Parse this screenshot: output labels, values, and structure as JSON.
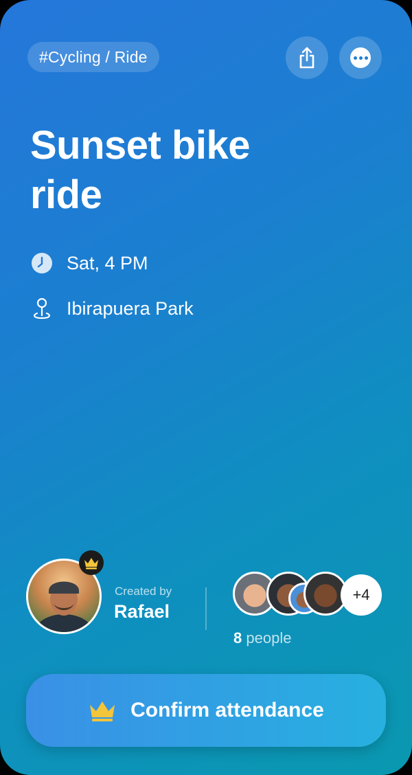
{
  "event": {
    "tag": "#Cycling / Ride",
    "title": "Sunset bike ride",
    "time": "Sat, 4 PM",
    "location": "Ibirapuera Park"
  },
  "actions": {
    "share_icon": "share-icon",
    "more_icon": "more-options-icon"
  },
  "creator": {
    "label": "Created by",
    "name": "Rafael",
    "badge_icon": "crown-icon"
  },
  "attendees": {
    "extra_count": "+4",
    "total": "8",
    "total_label": "people"
  },
  "confirm_button": {
    "icon": "crown-icon",
    "label": "Confirm attendance"
  },
  "colors": {
    "gradient_start": "#2577da",
    "gradient_end": "#0a98b0",
    "crown": "#f3c53b"
  }
}
